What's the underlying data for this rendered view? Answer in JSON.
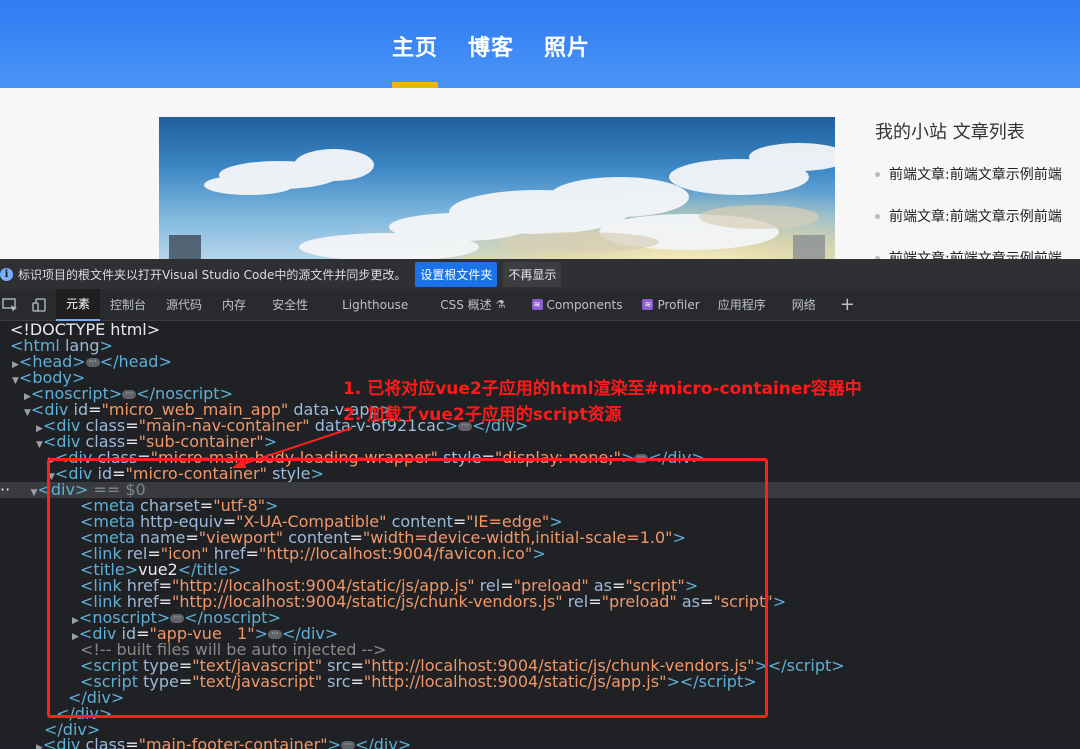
{
  "site": {
    "nav": [
      "主页",
      "博客",
      "照片"
    ],
    "active_nav_index": 0,
    "sidebar_title": "我的小站 文章列表",
    "articles": [
      "前端文章:前端文章示例前端",
      "前端文章:前端文章示例前端",
      "前端文章:前端文章示例前端"
    ]
  },
  "infobar": {
    "message": "标识项目的根文件夹以打开Visual Studio Code中的源文件并同步更改。",
    "primary_button": "设置根文件夹",
    "secondary_button": "不再显示"
  },
  "tabs": {
    "items": [
      "元素",
      "控制台",
      "源代码",
      "内存",
      "安全性",
      "Lighthouse",
      "CSS 概述",
      "Components",
      "Profiler",
      "应用程序",
      "网络"
    ],
    "active": "元素"
  },
  "tree": {
    "l1": "<!DOCTYPE html>",
    "l2_tag": "html",
    "l2_attr": "lang",
    "l3_tag": "head",
    "l4_tag": "body",
    "l5_tag": "noscript",
    "l6_tag": "div",
    "l6_attr": "id",
    "l6_val": "\"micro_web_main_app\"",
    "l6_attr2": "data-v-app",
    "l7_attr": "class",
    "l7_val": "\"main-nav-container\"",
    "l7_attr2": "data-v-6f921cac",
    "l8_val": "\"sub-container\"",
    "l9_val": "\"micro-main-body-loading-wrapper\"",
    "l9_attr2": "style",
    "l9_val2": "\"display: none;\"",
    "l10_val": "\"micro-container\"",
    "l10_attr2": "style",
    "l11_eq": "== $0",
    "l12_attr": "charset",
    "l12_val": "\"utf-8\"",
    "l13_attr": "http-equiv",
    "l13_val": "\"X-UA-Compatible\"",
    "l13_attr2": "content",
    "l13_val2": "\"IE=edge\"",
    "l14_attr": "name",
    "l14_val": "\"viewport\"",
    "l14_attr2": "content",
    "l14_val2": "\"width=device-width,initial-scale=1.0\"",
    "l15_attr": "rel",
    "l15_val": "\"icon\"",
    "l15_attr2": "href",
    "l15_val2": "\"http://localhost:9004/favicon.ico\"",
    "l16_text": "vue2",
    "l17_attr": "href",
    "l17_val": "\"http://localhost:9004/static/js/app.js\"",
    "l17_attr2": "rel",
    "l17_val2": "\"preload\"",
    "l17_attr3": "as",
    "l17_val3": "\"script\"",
    "l18_val": "\"http://localhost:9004/static/js/chunk-vendors.js\"",
    "l20_val": "\"app-vue   1\"",
    "l21_comment": "<!-- built files will be auto injected -->",
    "l22_attr": "type",
    "l22_val": "\"text/javascript\"",
    "l22_attr2": "src",
    "l22_val2": "\"http://localhost:9004/static/js/chunk-vendors.js\"",
    "l23_val2": "\"http://localhost:9004/static/js/app.js\"",
    "l27_val": "\"main-footer-container\""
  },
  "annotations": {
    "line1": "1. 已将对应vue2子应用的html渲染至#micro-container容器中",
    "line2": "2. 加载了vue2子应用的script资源"
  },
  "colors": {
    "header": "#2f7bf2",
    "active_underline": "#f5b301",
    "annotation": "#ff1a1a"
  }
}
